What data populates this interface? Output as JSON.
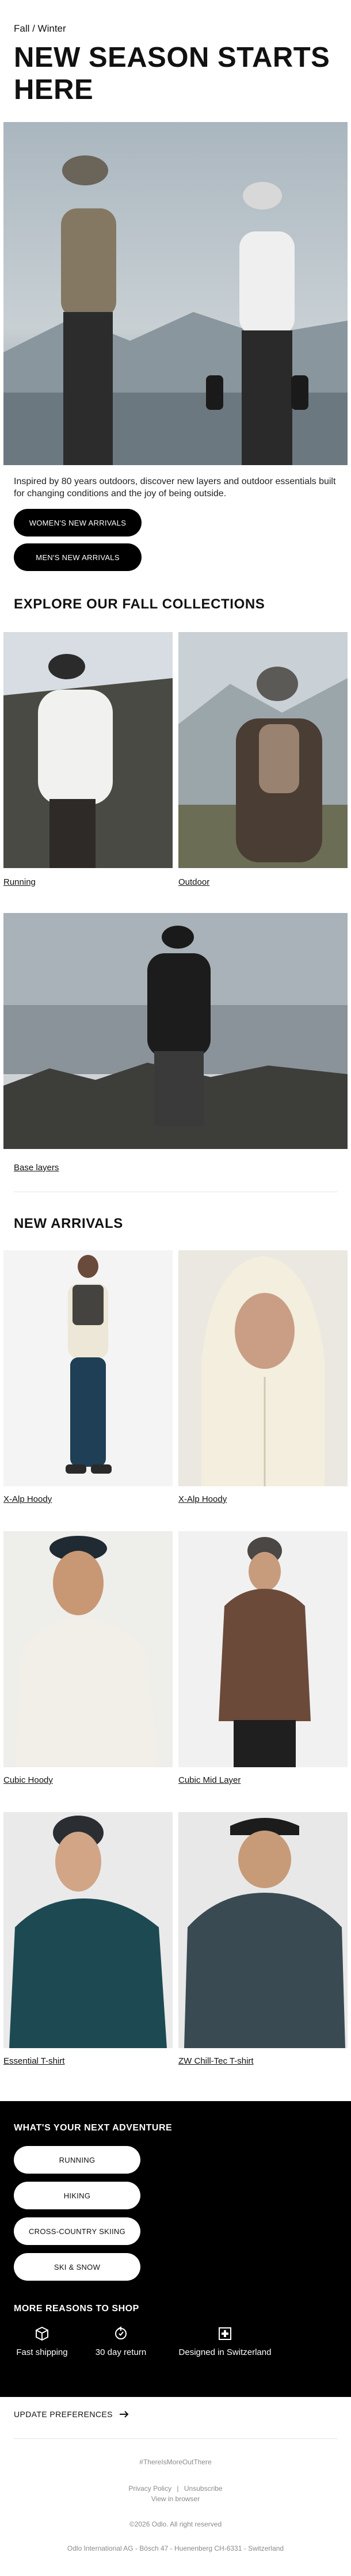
{
  "header": {
    "eyebrow": "Fall / Winter",
    "title": "NEW SEASON STARTS HERE"
  },
  "intro": {
    "text": "Inspired by 80 years outdoors, discover new layers and outdoor essentials built for changing conditions and the joy of being outside.",
    "buttons": [
      "WOMEN'S NEW ARRIVALS",
      "MEN'S NEW ARRIVALS"
    ]
  },
  "collections": {
    "title": "EXPLORE OUR FALL COLLECTIONS",
    "items": [
      "Running",
      "Outdoor",
      "Base layers"
    ]
  },
  "new_arrivals": {
    "title": "NEW ARRIVALS",
    "items": [
      "X-Alp Hoody",
      "X-Alp Hoody",
      "Cubic Hoody",
      "Cubic Mid Layer",
      "Essential T-shirt",
      "ZW Chill-Tec T-shirt"
    ]
  },
  "adventure": {
    "title": "WHAT'S YOUR NEXT ADVENTURE",
    "buttons": [
      "RUNNING",
      "HIKING",
      "CROSS-COUNTRY SKIING",
      "SKI & SNOW"
    ],
    "reasons_title": "MORE REASONS TO SHOP",
    "reasons": [
      {
        "icon": "box-icon",
        "label": "Fast shipping"
      },
      {
        "icon": "return-icon",
        "label": "30 day return"
      },
      {
        "icon": "swiss-cross-icon",
        "label": "Designed in Switzerland"
      }
    ]
  },
  "preferences": {
    "label": "UPDATE PREFERENCES"
  },
  "footer": {
    "hashtag": "#ThereIsMoreOutThere",
    "privacy": "Privacy Policy",
    "separator": "|",
    "unsubscribe": "Unsubscribe",
    "browser": "View in browser",
    "copyright": "©2026 Odlo. All right reserved",
    "address": "Odlo International AG - Bösch 47 - Huenenberg CH-6331 - Switzerland"
  },
  "colors": {
    "black": "#000000",
    "white": "#ffffff",
    "muted": "#8a8a8a"
  }
}
